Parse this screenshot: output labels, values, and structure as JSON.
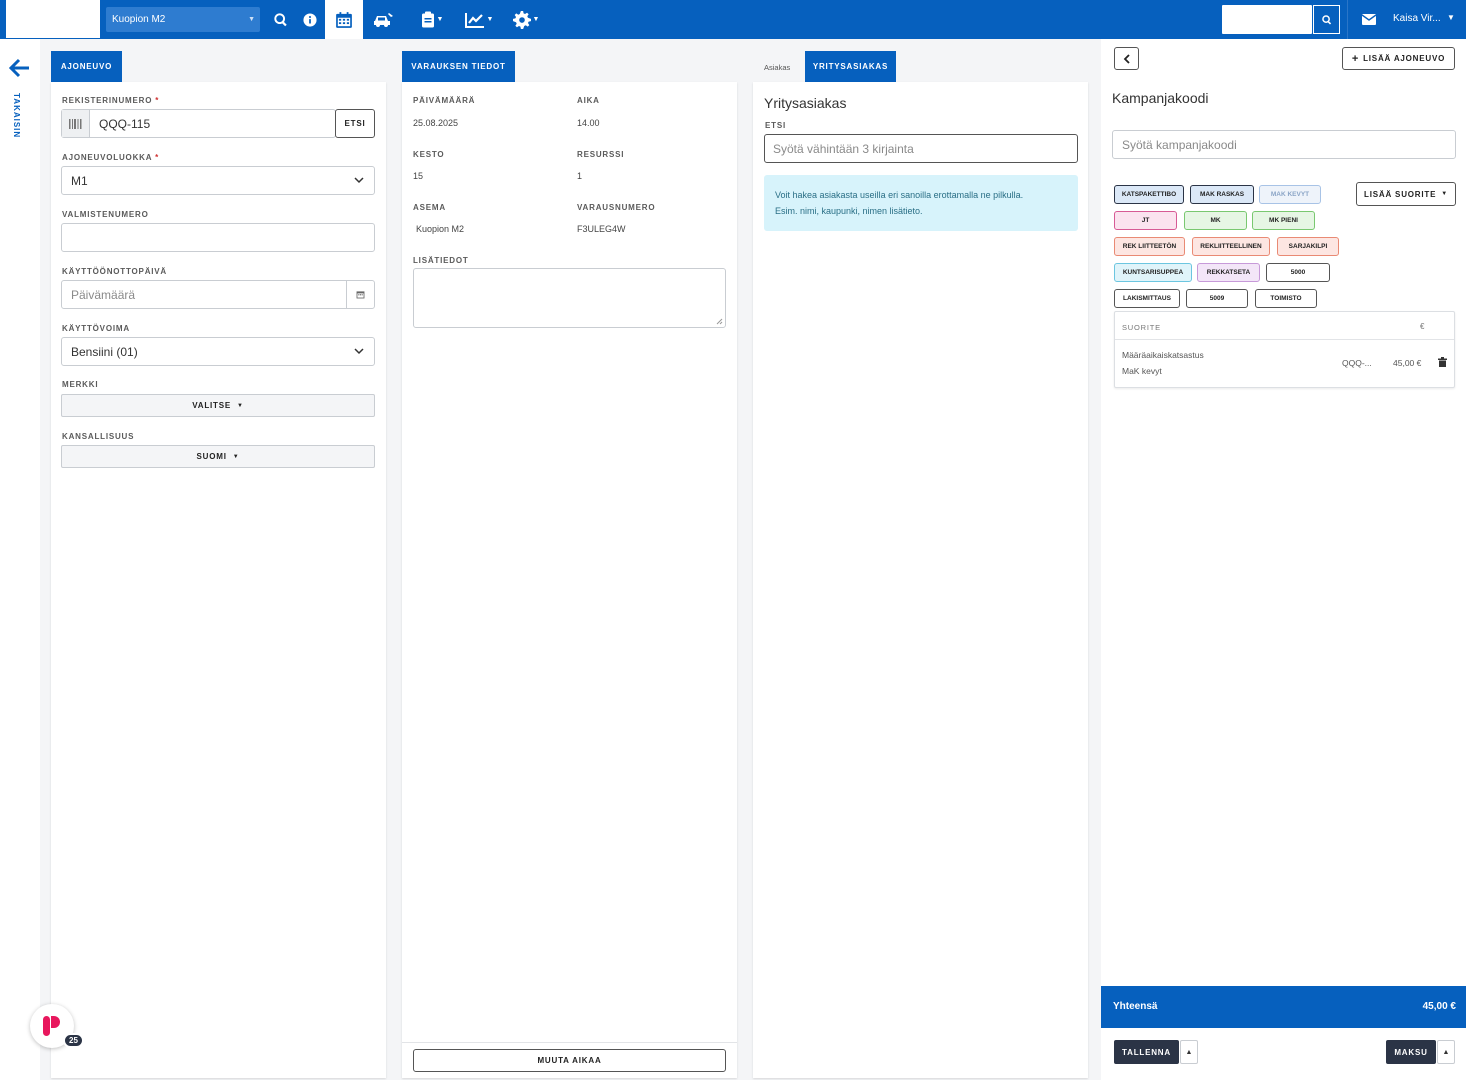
{
  "topbar": {
    "station": "Kuopion M2",
    "user": "Kaisa Vir..."
  },
  "left_rail": {
    "back_label": "TAKAISIN"
  },
  "vehicle": {
    "tab": "AJONEUVO",
    "reg_label": "REKISTERINUMERO",
    "reg_value": "QQQ-115",
    "search_btn": "ETSI",
    "class_label": "AJONEUVOLUOKKA",
    "class_value": "M1",
    "vin_label": "VALMISTENUMERO",
    "vin_value": "",
    "reg_date_label": "KÄYTTÖÖNOTTOPÄIVÄ",
    "reg_date_placeholder": "Päivämäärä",
    "fuel_label": "KÄYTTÖVOIMA",
    "fuel_value": "Bensiini (01)",
    "make_label": "MERKKI",
    "make_btn": "VALITSE",
    "nationality_label": "KANSALLISUUS",
    "nationality_btn": "SUOMI"
  },
  "booking": {
    "tab": "VARAUKSEN TIEDOT",
    "date_label": "PÄIVÄMÄÄRÄ",
    "date_value": "25.08.2025",
    "time_label": "AIKA",
    "time_value": "14.00",
    "duration_label": "KESTO",
    "duration_value": "15",
    "resource_label": "RESURSSI",
    "resource_value": "1",
    "station_label": "ASEMA",
    "station_value": "Kuopion M2",
    "booking_no_label": "VARAUSNUMERO",
    "booking_no_value": "F3ULEG4W",
    "notes_label": "LISÄTIEDOT",
    "change_time_btn": "MUUTA AIKAA"
  },
  "customer": {
    "tab_customer": "Asiakas",
    "tab_company": "YRITYSASIAKAS",
    "heading": "Yritysasiakas",
    "search_label": "ETSI",
    "search_placeholder": "Syötä vähintään 3 kirjainta",
    "info_line1": "Voit hakea asiakasta useilla eri sanoilla erottamalla ne pilkulla.",
    "info_line2": "Esim. nimi, kaupunki, nimen lisätieto."
  },
  "campaign": {
    "add_vehicle_btn": "LISÄÄ AJONEUVO",
    "heading": "Kampanjakoodi",
    "code_placeholder": "Syötä kampanjakoodi",
    "add_service_btn": "LISÄÄ SUORITE",
    "chips": [
      {
        "label": "KATSPAKETTIBO",
        "bg": "#dbe8f7",
        "border": "#2b3446"
      },
      {
        "label": "MAK RASKAS",
        "bg": "#dbe8f7",
        "border": "#2b3446"
      },
      {
        "label": "MAK KEVYT",
        "bg": "#eef3fa",
        "border": "#a8c3e6"
      },
      {
        "label": "JT",
        "bg": "#fbe3ef",
        "border": "#d75a95"
      },
      {
        "label": "MK",
        "bg": "#e6f6e4",
        "border": "#79c870"
      },
      {
        "label": "MK PIENI",
        "bg": "#e6f6e4",
        "border": "#79c870"
      },
      {
        "label": "REK LIITTEETÖN",
        "bg": "#fde6e2",
        "border": "#e98a74"
      },
      {
        "label": "REKLIITTEELLINEN",
        "bg": "#fde6e2",
        "border": "#e98a74"
      },
      {
        "label": "SARJAKILPI",
        "bg": "#fde6e2",
        "border": "#e98a74"
      },
      {
        "label": "KUNTSARISUPPEA",
        "bg": "#e0f4fa",
        "border": "#6cc6e0"
      },
      {
        "label": "REKKATSETA",
        "bg": "#f3e6f8",
        "border": "#c79ad9"
      },
      {
        "label": "5000",
        "bg": "#ffffff",
        "border": "#555555"
      },
      {
        "label": "LAKISMITTAUS",
        "bg": "#ffffff",
        "border": "#555555"
      },
      {
        "label": "5009",
        "bg": "#ffffff",
        "border": "#555555"
      },
      {
        "label": "TOIMISTO",
        "bg": "#ffffff",
        "border": "#555555"
      }
    ],
    "table_header_service": "SUORITE",
    "table_header_currency": "€",
    "row_service": "Määräaikaiskatsastus",
    "row_subtitle": "MaK kevyt",
    "row_reg": "QQQ-...",
    "row_price": "45,00 €",
    "total_label": "Yhteensä",
    "total_value": "45,00 €",
    "save_btn": "TALLENNA",
    "pay_btn": "MAKSU"
  },
  "badge": {
    "count": "25"
  },
  "colors": {
    "primary": "#0660be",
    "dark": "#2b3446",
    "required": "#d03232",
    "info_bg": "#d7f3fb"
  }
}
